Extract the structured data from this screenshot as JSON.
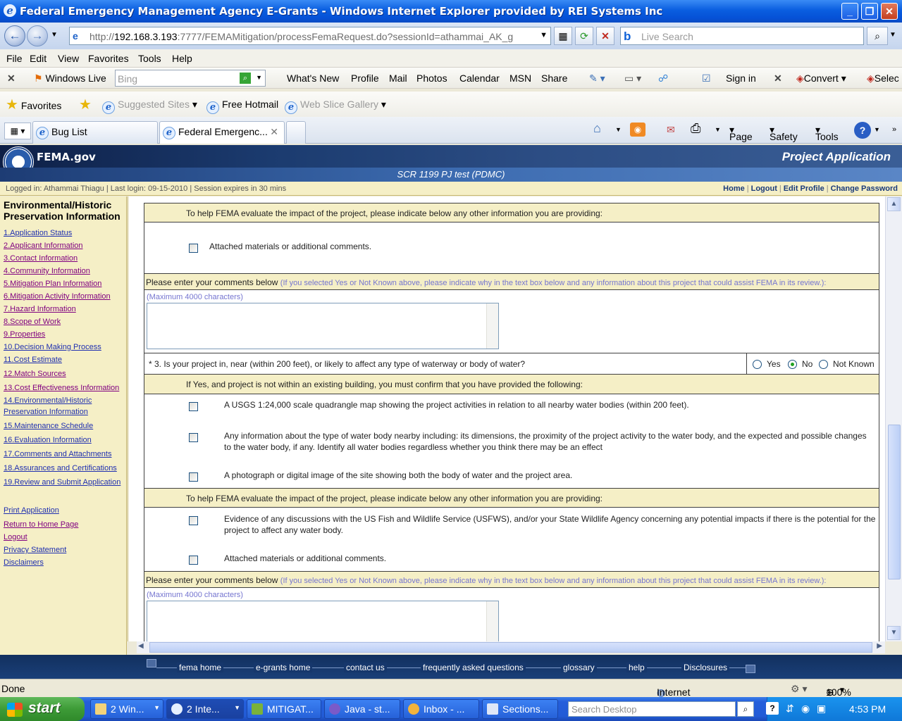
{
  "window": {
    "title": "Federal Emergency Management Agency E-Grants - Windows Internet Explorer provided by REI Systems Inc"
  },
  "address": {
    "url_prefix": "http://",
    "url_host": "192.168.3.193",
    "url_rest": ":7777/FEMAMitigation/processFemaRequest.do?sessionId=athammai_AK_g",
    "live_search_placeholder": "Live Search"
  },
  "menu": [
    "File",
    "Edit",
    "View",
    "Favorites",
    "Tools",
    "Help"
  ],
  "livebar": {
    "brand": "Windows Live",
    "bing_placeholder": "Bing",
    "links": [
      "What's New",
      "Profile",
      "Mail",
      "Photos",
      "Calendar",
      "MSN",
      "Share"
    ],
    "sign_in": "Sign in",
    "convert": "Convert",
    "select": "Selec"
  },
  "favbar": {
    "favorites": "Favorites",
    "suggested": "Suggested Sites",
    "hotmail": "Free Hotmail",
    "webslice": "Web Slice Gallery"
  },
  "tabs": [
    {
      "label": "Bug List"
    },
    {
      "label": "Federal Emergenc..."
    }
  ],
  "cmdbar": {
    "page": "Page",
    "safety": "Safety",
    "tools": "Tools"
  },
  "fema": {
    "logo": "FEMA.gov",
    "project_title": "Project Application",
    "subtitle": "SCR 1199 PJ test (PDMC)",
    "login_info": "Logged in: Athammai Thiagu   |  Last login: 09-15-2010   |  Session expires in 30 mins",
    "top_links": [
      "Home",
      "Logout",
      "Edit Profile",
      "Change Password"
    ]
  },
  "sidebar": {
    "title": "Environmental/Historic Preservation Information",
    "steps": [
      "1.Application Status",
      "2.Applicant Information",
      "3.Contact Information",
      "4.Community Information",
      "5.Mitigation Plan Information",
      "6.Mitigation Activity Information",
      "7.Hazard Information",
      "8.Scope of Work",
      "9.Properties",
      "10.Decision Making Process",
      "11.Cost Estimate",
      "12.Match Sources",
      "13.Cost Effectiveness Information",
      "14.Environmental/Historic Preservation Information",
      "15.Maintenance Schedule",
      "16.Evaluation Information",
      "17.Comments and Attachments",
      "18.Assurances and Certifications",
      "19.Review and Submit Application"
    ],
    "extra": [
      "Print Application",
      "Return to Home Page",
      "Logout",
      "Privacy Statement",
      "Disclaimers"
    ]
  },
  "form": {
    "other_info_header": "To help FEMA evaluate the impact of the project, please indicate below any other information you are providing:",
    "attached_materials": "Attached materials or additional comments.",
    "comments_label": "Please enter your comments below",
    "comments_note": "(If you selected Yes or Not Known above, please indicate why in the text box below and any information about this project that could assist FEMA in its review.):",
    "max_chars": "(Maximum 4000 characters)",
    "q3_text": "* 3.  Is your project in, near (within 200 feet), or likely to affect any type of waterway or body of water?",
    "radio_options": [
      "Yes",
      "No",
      "Not Known"
    ],
    "radio_selected": "No",
    "if_yes_header": "If Yes, and project is not within an existing building, you must confirm that you have provided the following:",
    "confirm_items": [
      "A USGS 1:24,000 scale quadrangle map showing the project activities in relation to all nearby water bodies (within 200 feet).",
      "Any information about the type of water body nearby including: its dimensions, the proximity of the project activity to the water body, and the expected and possible changes to the water body, if any. Identify all water bodies regardless whether you think there may be an effect",
      "A photograph or digital image of the site showing both the body of water and the project area."
    ],
    "evidence_item": "Evidence of any discussions with the US Fish and Wildlife Service (USFWS), and/or your State Wildlife Agency concerning any potential impacts if there is the potential for the project to affect any water body."
  },
  "footer": {
    "links": [
      "fema home",
      "e-grants home",
      "contact us",
      "frequently asked questions",
      "glossary",
      "help",
      "Disclosures"
    ]
  },
  "status": {
    "left": "Done",
    "zone": "Internet",
    "zoom": "100%"
  },
  "taskbar": {
    "start": "start",
    "tasks": [
      "2 Win...",
      "2 Inte...",
      "MITIGAT...",
      "Java - st...",
      "Inbox - ...",
      "Sections..."
    ],
    "search_placeholder": "Search Desktop",
    "clock": "4:53 PM"
  },
  "colors": {
    "tan": "#f5efc6",
    "link": "#1f2fb0",
    "visited": "#800080",
    "header_blue": "#1b3b6f"
  }
}
